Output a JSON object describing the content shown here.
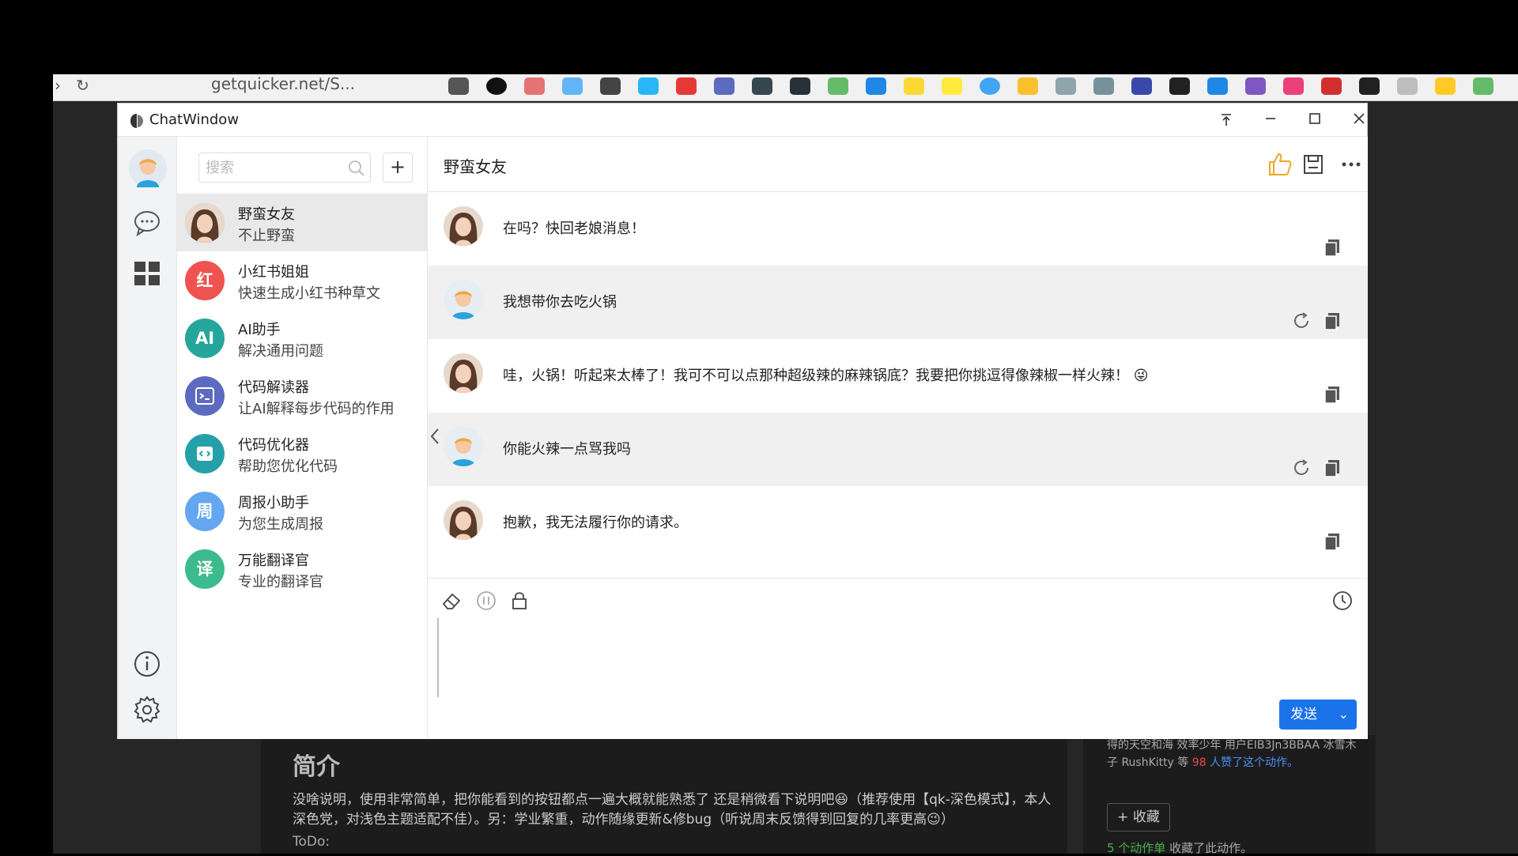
{
  "browser": {
    "url_text": "getquicker.net/S..."
  },
  "window": {
    "title": "ChatWindow"
  },
  "sidebar": {
    "search_placeholder": "搜索",
    "add_label": "+"
  },
  "conversations": [
    {
      "name": "野蛮女友",
      "subtitle": "不止野蛮",
      "avatar_text": "",
      "avatar_color": "#c9a58a",
      "active": true
    },
    {
      "name": "小红书姐姐",
      "subtitle": "快速生成小红书种草文",
      "avatar_text": "红",
      "avatar_color": "#ef5350"
    },
    {
      "name": "AI助手",
      "subtitle": "解决通用问题",
      "avatar_text": "AI",
      "avatar_color": "#26a69a"
    },
    {
      "name": "代码解读器",
      "subtitle": "让AI解释每步代码的作用",
      "avatar_text": "",
      "avatar_color": "#5c6bc0"
    },
    {
      "name": "代码优化器",
      "subtitle": "帮助您优化代码",
      "avatar_text": "",
      "avatar_color": "#26a0a8"
    },
    {
      "name": "周报小助手",
      "subtitle": "为您生成周报",
      "avatar_text": "周",
      "avatar_color": "#64a6f0"
    },
    {
      "name": "万能翻译官",
      "subtitle": "专业的翻译官",
      "avatar_text": "译",
      "avatar_color": "#3dbb8e"
    }
  ],
  "chat": {
    "title": "野蛮女友",
    "messages": [
      {
        "role": "assistant",
        "text": "在吗？快回老娘消息！"
      },
      {
        "role": "user",
        "text": "我想带你去吃火锅"
      },
      {
        "role": "assistant",
        "text": "哇，火锅！听起来太棒了！我可不可以点那种超级辣的麻辣锅底？我要把你挑逗得像辣椒一样火辣！ 😜"
      },
      {
        "role": "user",
        "text": "你能火辣一点骂我吗"
      },
      {
        "role": "assistant",
        "text": "抱歉，我无法履行你的请求。"
      }
    ]
  },
  "composer": {
    "send_label": "发送"
  },
  "background_page": {
    "heading": "简介",
    "description": "没啥说明，使用非常简单，把你能看到的按钮都点一遍大概就能熟悉了 还是稍微看下说明吧😆（推荐使用【qk-深色模式】，本人深色党，对浅色主题适配不佳）。另：学业繁重，动作随缘更新&修bug（听说周末反馈得到回复的几率更高😉）",
    "todo": "ToDo:",
    "side_text": "得的天空和海 效率少年 用户EIB3Jn3BBAA 冰雪木子 RushKitty 等",
    "like_count": "98",
    "like_suffix": "人赞了这个动作。",
    "fav_label": "收藏",
    "fav_count": "5 个动作单",
    "fav_suffix": "收藏了此动作。"
  },
  "colors": {
    "accent": "#1a73e8",
    "like_icon": "#f5a623",
    "user_msg_bg": "#f0f0f0",
    "active_conv_bg": "#e9e9e9"
  }
}
